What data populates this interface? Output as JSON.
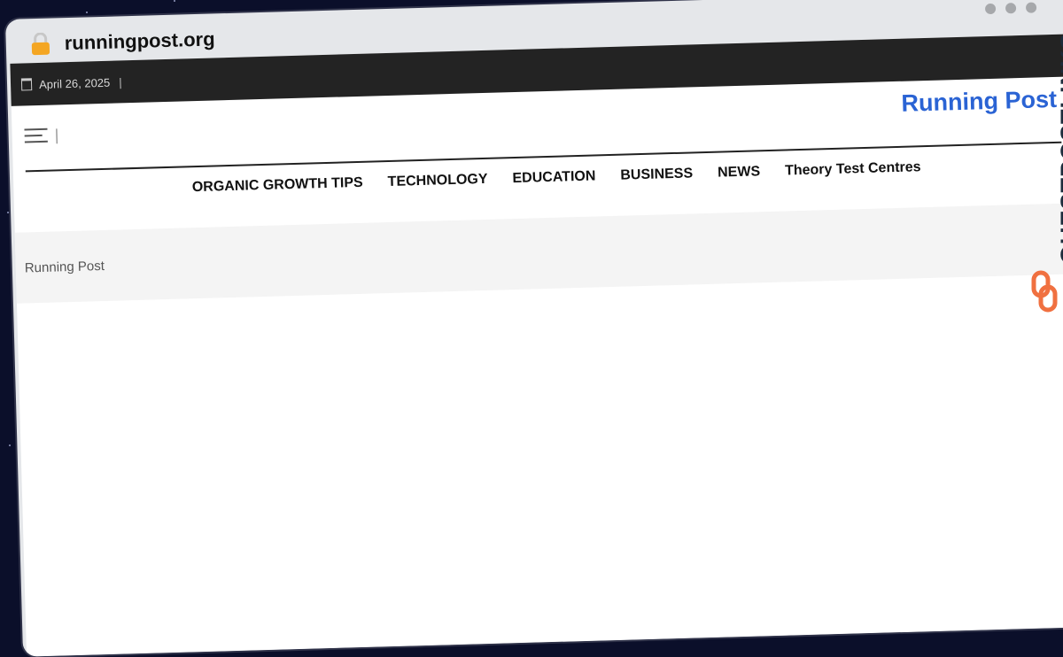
{
  "browser": {
    "url": "runningpost.org",
    "lock_icon": "lock-icon"
  },
  "topbar": {
    "date": "April 26, 2025",
    "separator": "|"
  },
  "header": {
    "site_title": "Running Post",
    "menu_separator": "|"
  },
  "nav": {
    "items": [
      {
        "label": "ORGANIC GROWTH TIPS"
      },
      {
        "label": "TECHNOLOGY"
      },
      {
        "label": "EDUCATION"
      },
      {
        "label": "BUSINESS"
      },
      {
        "label": "NEWS"
      },
      {
        "label": "Theory Test Centres"
      }
    ]
  },
  "banner": {
    "breadcrumb": "Running Post"
  },
  "watermark": {
    "text": "GUESTPOSTLINKS"
  },
  "colors": {
    "site_title": "#2a63d4",
    "topbar_bg": "#232323",
    "lock": "#f4a623",
    "brand_accent": "#f07040"
  }
}
